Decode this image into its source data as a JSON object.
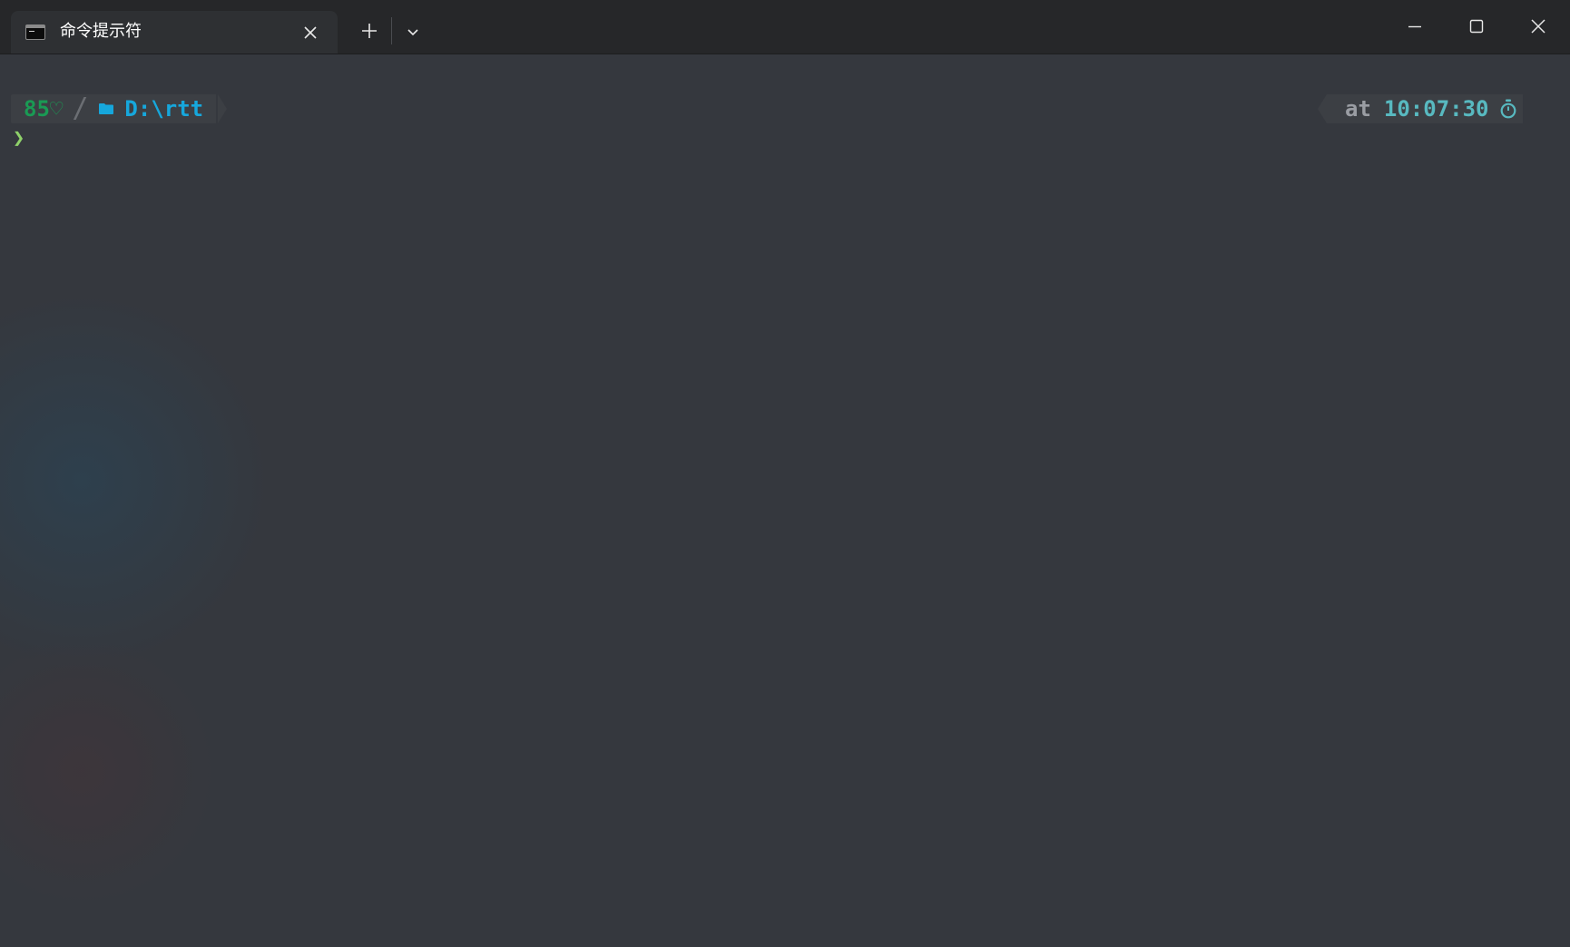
{
  "window": {
    "tab_title": "命令提示符",
    "tab_icon": "cmd-icon",
    "buttons": [
      "close-tab",
      "new-tab",
      "dropdown",
      "minimize",
      "maximize",
      "close-window"
    ]
  },
  "prompt": {
    "battery": "85♡",
    "separator": "/",
    "path": "D:\\rtt",
    "at_label": "at",
    "time": "10:07:30",
    "caret": "❯"
  },
  "colors": {
    "battery": "#1a9a54",
    "path": "#16a7dc",
    "time": "#58b9c0",
    "caret": "#8fd16a",
    "background": "#35383e"
  }
}
